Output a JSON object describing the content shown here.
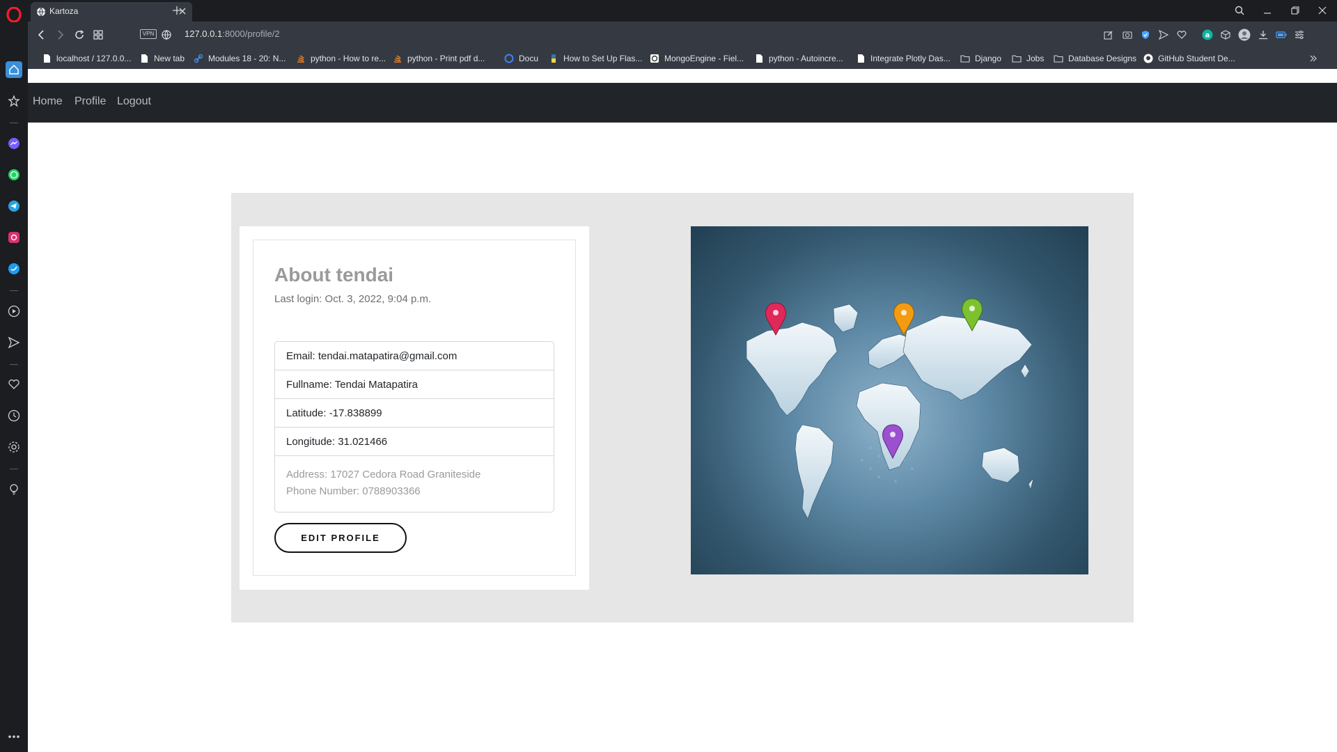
{
  "browser": {
    "tab_title": "Kartoza",
    "url_host": "127.0.0.1",
    "url_path": ":8000/profile/2",
    "vpn_label": "VPN",
    "bookmarks": [
      {
        "label": "localhost / 127.0.0...",
        "icon": "doc-icon"
      },
      {
        "label": "New tab",
        "icon": "doc-icon"
      },
      {
        "label": "Modules 18 - 20: N...",
        "icon": "link-icon"
      },
      {
        "label": "python - How to re...",
        "icon": "stack-icon"
      },
      {
        "label": "python - Print pdf d...",
        "icon": "stack-icon"
      },
      {
        "label": "Docu",
        "icon": "docu-icon"
      },
      {
        "label": "How to Set Up Flas...",
        "icon": "python-icon"
      },
      {
        "label": "MongoEngine - Fiel...",
        "icon": "mongo-icon"
      },
      {
        "label": "python - Autoincre...",
        "icon": "doc-icon"
      },
      {
        "label": "Integrate Plotly Das...",
        "icon": "doc-icon"
      },
      {
        "label": "Django",
        "icon": "folder-icon"
      },
      {
        "label": "Jobs",
        "icon": "folder-icon"
      },
      {
        "label": "Database Designs",
        "icon": "folder-icon"
      },
      {
        "label": "GitHub Student De...",
        "icon": "github-icon"
      }
    ]
  },
  "site": {
    "nav": {
      "home": "Home",
      "profile": "Profile",
      "logout": "Logout"
    }
  },
  "profile": {
    "title": "About tendai",
    "last_login": "Last login: Oct. 3, 2022, 9:04 p.m.",
    "email": "Email: tendai.matapatira@gmail.com",
    "fullname": "Fullname: Tendai Matapatira",
    "latitude": "Latitude: -17.838899",
    "longitude": "Longitude: 31.021466",
    "address": "Address: 17027 Cedora Road Graniteside",
    "phone": "Phone Number: 0788903366",
    "edit_button": "EDIT PROFILE"
  },
  "colors": {
    "navbar": "#212529",
    "panel": "#e6e6e6",
    "pin_red": "#e0285a",
    "pin_orange": "#f39c12",
    "pin_green": "#7cc22f",
    "pin_purple": "#9b4fd1"
  }
}
